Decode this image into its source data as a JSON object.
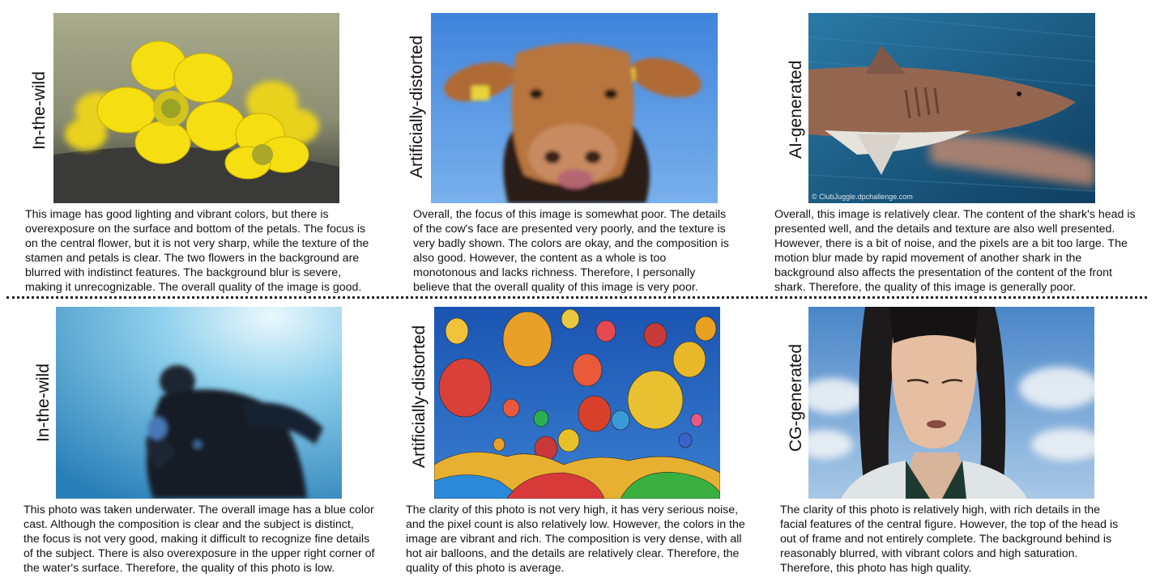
{
  "panels": [
    {
      "label": "In-the-wild",
      "caption": "This image has good lighting and vibrant colors, but there is\noverexposure on the surface and bottom of the petals. The focus is\non the central flower, but it is not very sharp, while the texture of the\nstamen and petals is clear. The two flowers in the background are\nblurred with indistinct features. The background blur is severe,\nmaking it unrecognizable. The overall quality of the image is good."
    },
    {
      "label": "Artificially-distorted",
      "caption": "Overall, the focus of this image is somewhat poor. The details\nof the cow's face are presented very poorly, and the texture is\nvery badly shown. The colors are okay, and the composition is\nalso good. However, the content as a whole is too\nmonotonous and lacks richness. Therefore, I personally\nbelieve that the overall quality of this image is very poor."
    },
    {
      "label": "AI-generated",
      "caption": "Overall, this image is relatively clear. The content of the shark's head is\npresented well, and the details and texture are also well presented.\nHowever, there is a bit of noise, and the pixels are a bit too large. The\nmotion blur made by rapid movement of another shark in the\nbackground also affects the presentation of the content of the front\nshark. Therefore, the quality of this image is generally poor.",
      "watermark": "© ClubJuggle.dpchallenge.com"
    },
    {
      "label": "In-the-wild",
      "caption": "This photo was taken underwater. The overall image has a blue color\ncast. Although the composition is clear and the subject is distinct,\nthe focus is not very good, making it difficult to recognize fine details\nof the subject. There is also overexposure in the upper right corner of\nthe water's surface. Therefore, the quality of this photo is low."
    },
    {
      "label": "Artificially-distorted",
      "caption": "The clarity of this photo is not very high, it has very serious noise,\nand the pixel count is also relatively low. However, the colors in the\nimage are vibrant and rich. The composition is very dense, with all\nhot air balloons, and the details are relatively clear. Therefore, the\nquality of this photo is average."
    },
    {
      "label": "CG-generated",
      "caption": "The clarity of this photo is relatively high, with rich details in the\nfacial features of the central figure. However, the top of the head is\nout of frame and not entirely complete. The background behind is\nreasonably blurred, with vibrant colors and high saturation.\nTherefore, this photo has high quality."
    }
  ],
  "images": [
    {
      "name": "yellow flowers photo",
      "colors": [
        "#9aa080",
        "#f2dc14",
        "#3c3c3a"
      ]
    },
    {
      "name": "cow photo",
      "colors": [
        "#4f90e0",
        "#b8743c",
        "#2a1a10"
      ]
    },
    {
      "name": "shark photo",
      "colors": [
        "#1c5f86",
        "#9a6a50",
        "#e6e6e6"
      ]
    },
    {
      "name": "underwater diver photo",
      "colors": [
        "#bfe6f6",
        "#3c8fc0",
        "#101820"
      ]
    },
    {
      "name": "hot air balloons photo",
      "colors": [
        "#1f5fc0",
        "#e8b02a",
        "#c0302a"
      ]
    },
    {
      "name": "CG character photo",
      "colors": [
        "#6fa0d8",
        "#e8c0a8",
        "#1a1a1a"
      ]
    }
  ]
}
